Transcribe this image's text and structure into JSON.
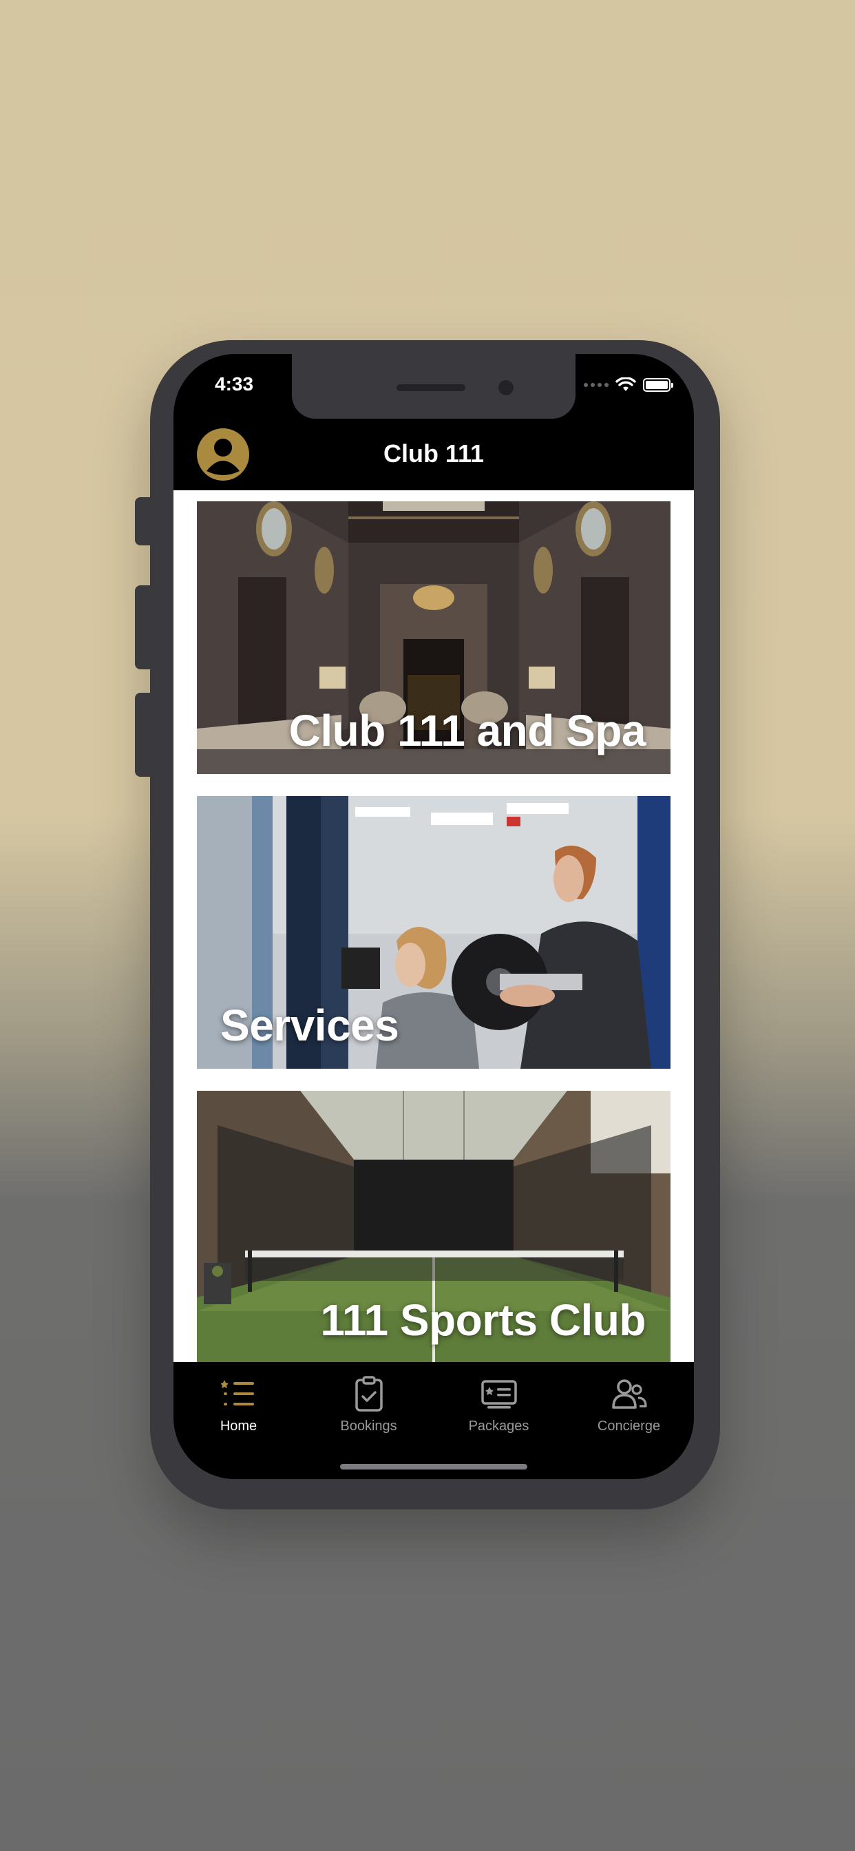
{
  "status_bar": {
    "time": "4:33"
  },
  "header": {
    "title": "Club 111"
  },
  "cards": [
    {
      "label": "Club 111 and Spa"
    },
    {
      "label": "Services"
    },
    {
      "label": "111 Sports Club"
    }
  ],
  "tabs": [
    {
      "label": "Home",
      "icon": "list-icon",
      "active": true
    },
    {
      "label": "Bookings",
      "icon": "clipboard-check-icon",
      "active": false
    },
    {
      "label": "Packages",
      "icon": "ticket-icon",
      "active": false
    },
    {
      "label": "Concierge",
      "icon": "people-icon",
      "active": false
    }
  ],
  "colors": {
    "accent": "#a98a3f",
    "background_top": "#d5c6a2",
    "background_bottom": "#6b6b6b"
  }
}
